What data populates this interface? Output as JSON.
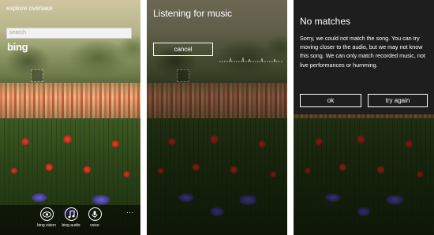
{
  "screen1": {
    "title": "explore overlake",
    "search_placeholder": "search",
    "brand": "bing",
    "appbar": {
      "buttons": [
        {
          "label": "bing vision",
          "icon": "eye-icon"
        },
        {
          "label": "bing audio",
          "icon": "music-note-icon"
        },
        {
          "label": "voice",
          "icon": "microphone-icon"
        }
      ],
      "more": "..."
    }
  },
  "screen2": {
    "title": "Listening for music",
    "cancel_label": "cancel"
  },
  "screen3": {
    "title": "No matches",
    "message": "Sorry, we could not match the song. You can try moving closer to the audio, but we may not know this song. We can only match recorded music, not live performances or humming.",
    "ok_label": "ok",
    "try_again_label": "try again"
  },
  "colors": {
    "text": "#ffffff",
    "dialog_bg": "#1e1e1e",
    "search_bg": "#f2f2f2"
  }
}
